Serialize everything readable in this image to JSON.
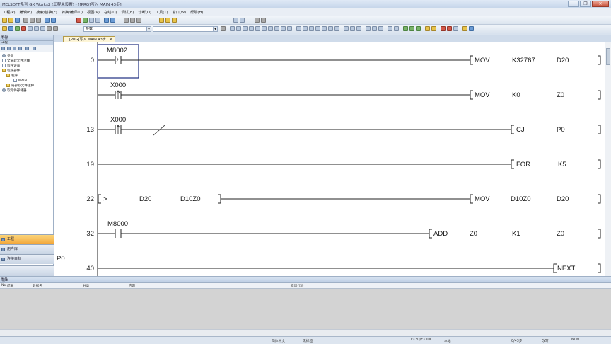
{
  "window": {
    "title": "MELSOFT系列 GX Works2 (工程未设置) - [[PRG]写入 MAIN 43步]"
  },
  "menubar": [
    "工程(P)",
    "编辑(E)",
    "搜索/替换(F)",
    "转换/编译(C)",
    "视图(V)",
    "在线(O)",
    "调试(B)",
    "诊断(D)",
    "工具(T)",
    "窗口(W)",
    "帮助(H)"
  ],
  "toolbar": {
    "param_combo": "参数"
  },
  "nav": {
    "title": "导航",
    "subtitle": "工程",
    "tree": [
      {
        "label": "参数",
        "indent": 0,
        "icon": "gear"
      },
      {
        "label": "全局软元件注释",
        "indent": 0,
        "icon": "doc"
      },
      {
        "label": "程序设置",
        "indent": 0,
        "icon": "doc"
      },
      {
        "label": "程序部件",
        "indent": 0,
        "icon": "folder"
      },
      {
        "label": "程序",
        "indent": 1,
        "icon": "folder"
      },
      {
        "label": "MAIN",
        "indent": 2,
        "icon": "doc"
      },
      {
        "label": "局部软元件注释",
        "indent": 1,
        "icon": "folder"
      },
      {
        "label": "软元件存储器",
        "indent": 0,
        "icon": "gear"
      }
    ],
    "tabs": [
      "工程",
      "用户库",
      "连接目标"
    ]
  },
  "editor": {
    "tab_label": "[PRG]写入 MAIN 43步",
    "p0_label": "P0",
    "rungs": [
      {
        "step": "0",
        "contact": "M8002",
        "instruction": [
          "MOV",
          "K32767",
          "D20"
        ]
      },
      {
        "step": "",
        "contact": "X000",
        "instruction": [
          "MOV",
          "K0",
          "Z0"
        ]
      },
      {
        "step": "13",
        "contact": "X000",
        "instruction": [
          "CJ",
          "P0"
        ]
      },
      {
        "step": "19",
        "contact": "",
        "instruction": [
          "FOR",
          "K5"
        ]
      },
      {
        "step": "22",
        "compare": [
          ">",
          "D20",
          "D10Z0"
        ],
        "instruction": [
          "MOV",
          "D10Z0",
          "D20"
        ]
      },
      {
        "step": "32",
        "contact": "M8000",
        "instruction": [
          "ADD",
          "Z0",
          "K1",
          "Z0"
        ]
      },
      {
        "step": "40",
        "contact": "",
        "instruction": [
          "NEXT"
        ]
      }
    ]
  },
  "output": {
    "title": "输出",
    "columns": [
      "No.",
      "结果",
      "数据名",
      "分类",
      "内容",
      "错误代码"
    ]
  },
  "statusbar": {
    "lang": "简体中文",
    "label": "无标签",
    "cpu": "FX3U/FX3UC",
    "station": "本站",
    "steps": "0/43步",
    "mode": "改写",
    "num": "NUM"
  }
}
